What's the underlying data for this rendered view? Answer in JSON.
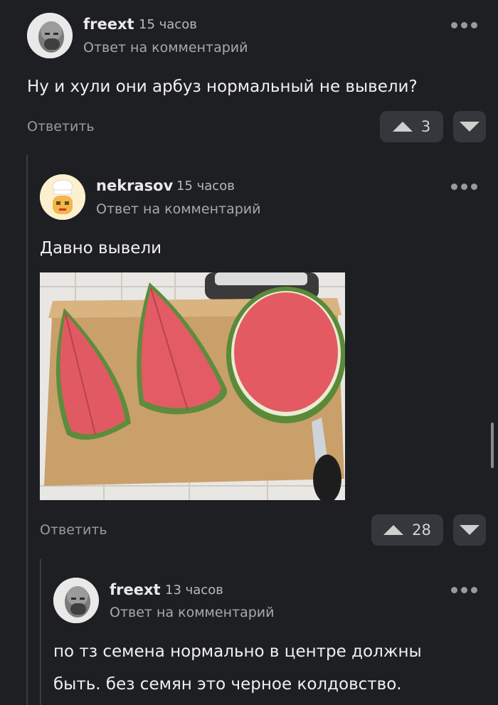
{
  "comments": [
    {
      "author": "freext",
      "time": "15 часов",
      "reply_label": "Ответ на комментарий",
      "text": "Ну и хули они арбуз нормальный не вывели?",
      "reply_button": "Ответить",
      "votes": "3"
    },
    {
      "author": "nekrasov",
      "time": "15 часов",
      "reply_label": "Ответ на комментарий",
      "text": "Давно вывели",
      "reply_button": "Ответить",
      "votes": "28"
    },
    {
      "author": "freext",
      "time": "13 часов",
      "reply_label": "Ответ на комментарий",
      "text_lines": [
        "по тз семена нормально в центре должны",
        "быть. без семян это черное колдовство."
      ]
    }
  ],
  "icons": {
    "more": "more-dots-icon",
    "upvote": "arrow-up-icon",
    "downvote": "arrow-down-icon"
  },
  "colors": {
    "background": "#1e1f23",
    "button": "#35373c",
    "watermelon_flesh": "#e45a62",
    "watermelon_rind": "#5c8a3a"
  }
}
